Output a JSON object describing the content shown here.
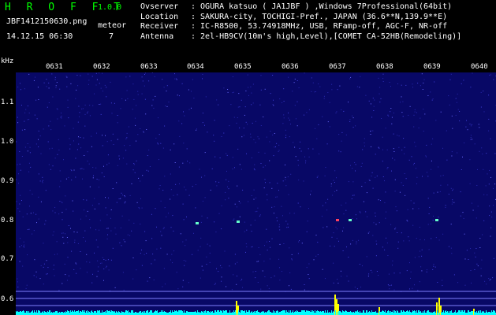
{
  "header": {
    "app_name": "H R O F F T",
    "version": "1.0.0",
    "file_name": "JBF1412150630.png",
    "datetime": "14.12.15 06:30",
    "meteor_label": "meteor",
    "meteor_count": "7",
    "info": [
      {
        "key": "Ovserver",
        "value": ": OGURA katsuo ( JA1JBF ) ,Windows 7Professional(64bit)"
      },
      {
        "key": "Location",
        "value": ": SAKURA-city, TOCHIGI-Pref., JAPAN (36.6**N,139.9**E)"
      },
      {
        "key": "Receiver",
        "value": ": IC-R8500, 53.74918MHz, USB, RFamp-off, AGC-F, NR-off"
      },
      {
        "key": "Antenna",
        "value": ": 2el-HB9CV(10m's high,Level),[COMET CA-52HB(Remodeling)]"
      }
    ]
  },
  "spectrogram": {
    "y_unit": "kHz",
    "y_ticks": [
      "1.1",
      "1.0",
      "0.9",
      "0.8",
      "0.7",
      "0.6"
    ],
    "x_ticks": [
      "0631",
      "0632",
      "0633",
      "0634",
      "0635",
      "0636",
      "0637",
      "0638",
      "0639",
      "0640"
    ],
    "background_color": "#080866",
    "signal_color": "#00ffff",
    "meteor_color": "#ffff00"
  }
}
